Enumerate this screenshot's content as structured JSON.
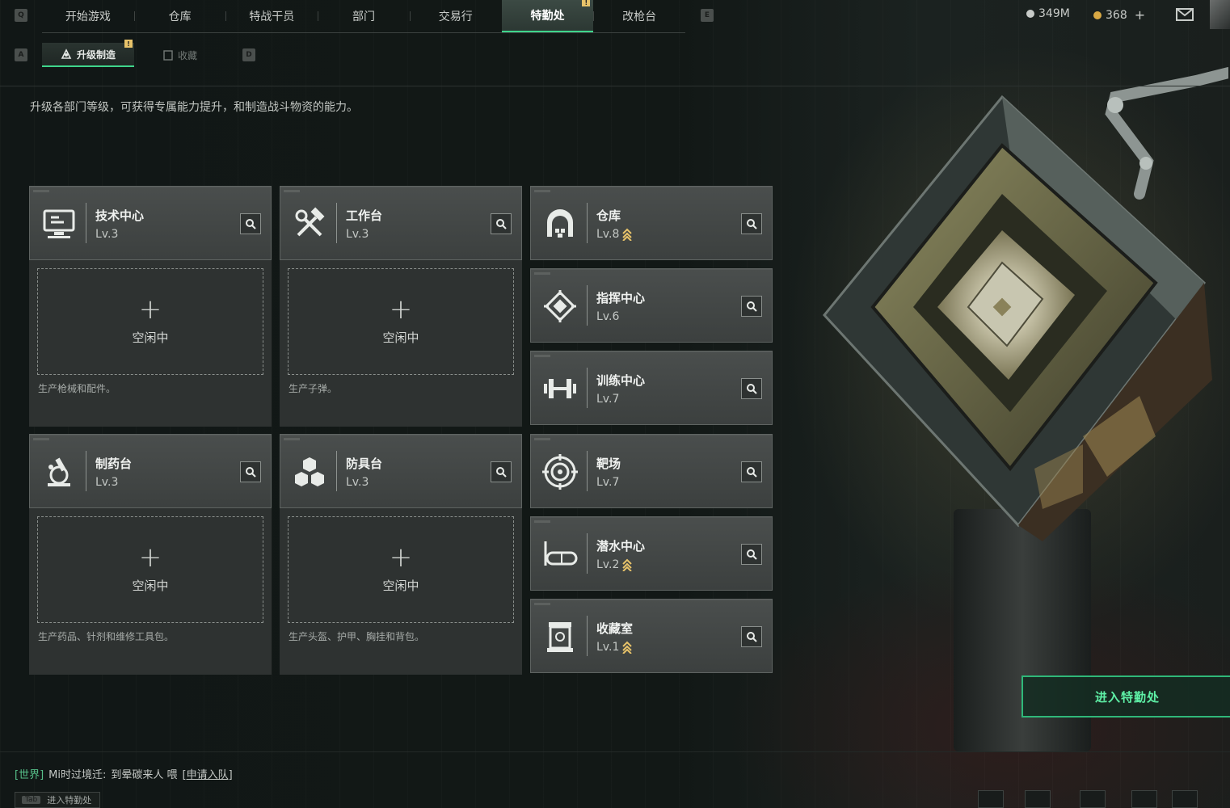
{
  "nav": {
    "left_key": "Q",
    "right_key": "E",
    "tabs": [
      {
        "label": "开始游戏",
        "active": false
      },
      {
        "label": "仓库",
        "active": false
      },
      {
        "label": "特战干员",
        "active": false
      },
      {
        "label": "部门",
        "active": false
      },
      {
        "label": "交易行",
        "active": false
      },
      {
        "label": "特勤处",
        "active": true,
        "alert": "!"
      },
      {
        "label": "改枪台",
        "active": false
      }
    ]
  },
  "currency": {
    "silver": "349M",
    "gold": "368",
    "add": "+"
  },
  "subnav": {
    "left_key": "A",
    "right_key": "D",
    "tabs": [
      {
        "label": "升级制造",
        "active": true,
        "alert": "!"
      },
      {
        "label": "收藏",
        "active": false
      }
    ]
  },
  "description": "升级各部门等级，可获得专属能力提升，和制造战斗物资的能力。",
  "production": [
    {
      "name": "技术中心",
      "level": "Lv.3",
      "icon": "computer-icon",
      "idle_label": "空闲中",
      "note": "生产枪械和配件。"
    },
    {
      "name": "工作台",
      "level": "Lv.3",
      "icon": "hammer-wrench-icon",
      "idle_label": "空闲中",
      "note": "生产子弹。"
    },
    {
      "name": "制药台",
      "level": "Lv.3",
      "icon": "microscope-icon",
      "idle_label": "空闲中",
      "note": "生产药品、针剂和维修工具包。"
    },
    {
      "name": "防具台",
      "level": "Lv.3",
      "icon": "cubes-icon",
      "idle_label": "空闲中",
      "note": "生产头盔、护甲、胸挂和背包。"
    }
  ],
  "facilities": [
    {
      "name": "仓库",
      "level": "Lv.8",
      "upgradable": true,
      "icon": "warehouse-icon"
    },
    {
      "name": "指挥中心",
      "level": "Lv.6",
      "upgradable": false,
      "icon": "command-icon"
    },
    {
      "name": "训练中心",
      "level": "Lv.7",
      "upgradable": false,
      "icon": "dumbbell-icon"
    },
    {
      "name": "靶场",
      "level": "Lv.7",
      "upgradable": false,
      "icon": "target-icon"
    },
    {
      "name": "潜水中心",
      "level": "Lv.2",
      "upgradable": true,
      "icon": "diving-mask-icon"
    },
    {
      "name": "收藏室",
      "level": "Lv.1",
      "upgradable": true,
      "icon": "display-case-icon"
    }
  ],
  "enter_button": "进入特勤处",
  "chat": {
    "channel": "[世界]",
    "user": "Mi时过境迁:",
    "message": "到晕碳来人 喂",
    "link": "[申请入队]"
  },
  "tab_hint": {
    "key": "Tab",
    "label": "进入特勤处"
  },
  "colors": {
    "accent": "#3fd58c",
    "card": "#45494a",
    "rank_up": "#e8c36a"
  }
}
